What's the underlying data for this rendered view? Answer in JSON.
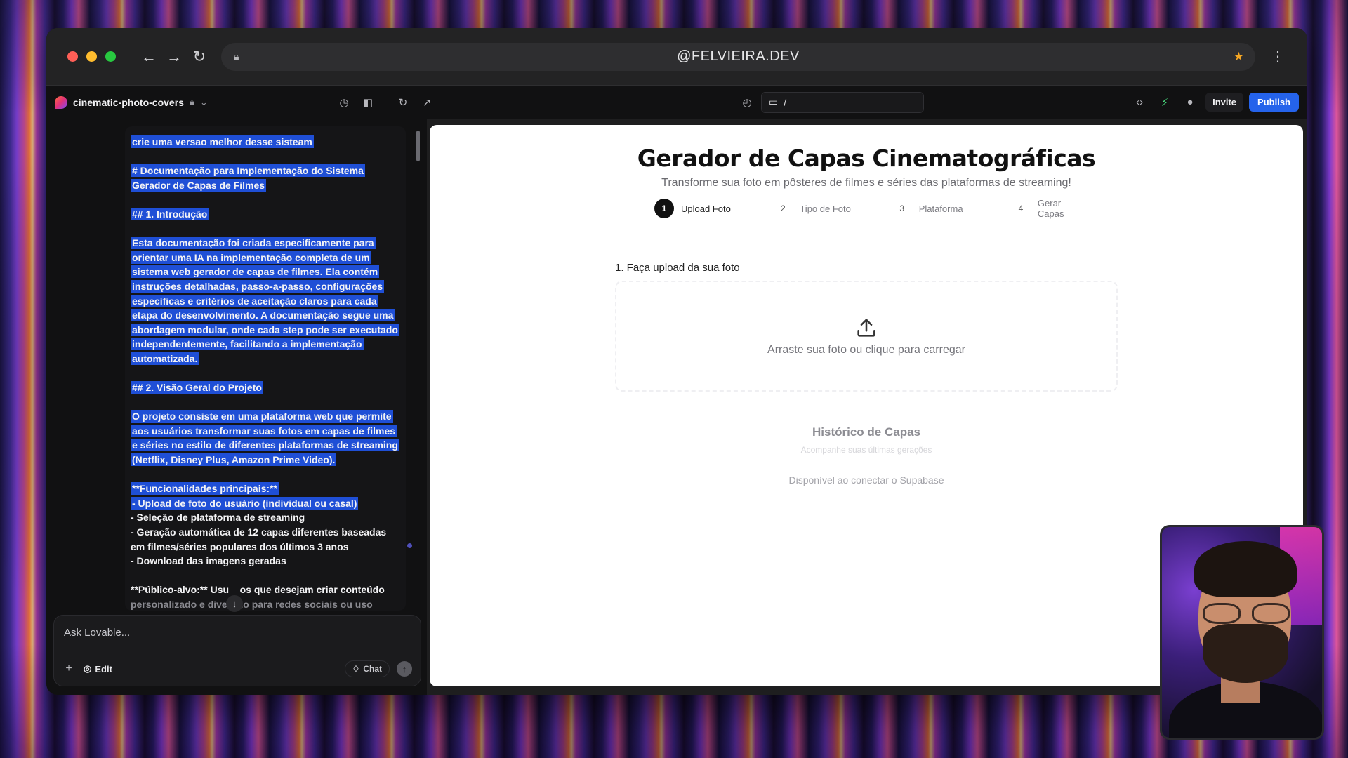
{
  "browser": {
    "url": "@FELVIEIRA.DEV"
  },
  "appbar": {
    "project_name": "cinematic-photo-covers",
    "route": "/",
    "invite_label": "Invite",
    "publish_label": "Publish"
  },
  "chat": {
    "paragraphs": [
      "crie uma versao melhor desse sisteam",
      "# Documentação para Implementação do Sistema Gerador de Capas de Filmes",
      "## 1. Introdução",
      "Esta documentação foi criada especificamente para orientar uma IA na implementação completa de um sistema web gerador de capas de filmes. Ela contém instruções detalhadas, passo-a-passo, configurações específicas e critérios de aceitação claros para cada etapa do desenvolvimento. A documentação segue uma abordagem modular, onde cada step pode ser executado independentemente, facilitando a implementação automatizada.",
      "## 2. Visão Geral do Projeto",
      "O projeto consiste em uma plataforma web que permite aos usuários transformar suas fotos em capas de filmes e séries no estilo de diferentes plataformas de streaming (Netflix, Disney Plus, Amazon Prime Video)."
    ],
    "features_title": "**Funcionalidades principais:**",
    "features": [
      "- Upload de foto do usuário (individual ou casal)",
      "- Seleção de plataforma de streaming",
      "- Geração automática de 12 capas diferentes baseadas em filmes/séries populares dos últimos 3 anos",
      "- Download das imagens geradas"
    ],
    "audience_line1": "**Público-alvo:** Usu",
    "audience_line1b": "os que desejam criar conteúdo",
    "audience_line2": "personalizado e divertido para redes sociais ou uso",
    "composer_placeholder": "Ask Lovable...",
    "edit_label": "Edit",
    "chat_label": "Chat"
  },
  "preview": {
    "title": "Gerador de Capas Cinematográficas",
    "subtitle": "Transforme sua foto em pôsteres de filmes e séries das plataformas de streaming!",
    "steps": [
      {
        "num": "1",
        "label": "Upload Foto",
        "active": true
      },
      {
        "num": "2",
        "label": "Tipo de Foto",
        "active": false
      },
      {
        "num": "3",
        "label": "Plataforma",
        "active": false
      },
      {
        "num": "4",
        "label": "Gerar Capas",
        "active": false
      }
    ],
    "upload_label": "1. Faça upload da sua foto",
    "dropzone_text": "Arraste sua foto ou clique para carregar",
    "history_title": "Histórico de Capas",
    "history_subtitle": "Acompanhe suas últimas gerações",
    "history_note": "Disponível ao conectar o Supabase"
  },
  "icons": {
    "back": "arrow-left-icon",
    "forward": "arrow-right-icon",
    "reload": "reload-icon",
    "lock": "lock-icon",
    "bookmark": "star-icon",
    "menu": "kebab-menu-icon",
    "history": "history-icon",
    "sidebar": "sidebar-toggle-icon",
    "refresh": "refresh-icon",
    "external": "open-external-icon",
    "code": "code-icon",
    "supabase": "bolt-icon",
    "github": "github-icon",
    "upload": "upload-icon"
  },
  "colors": {
    "accent": "#2563eb",
    "selection": "#1f4fd6",
    "supabase": "#4ade80"
  }
}
